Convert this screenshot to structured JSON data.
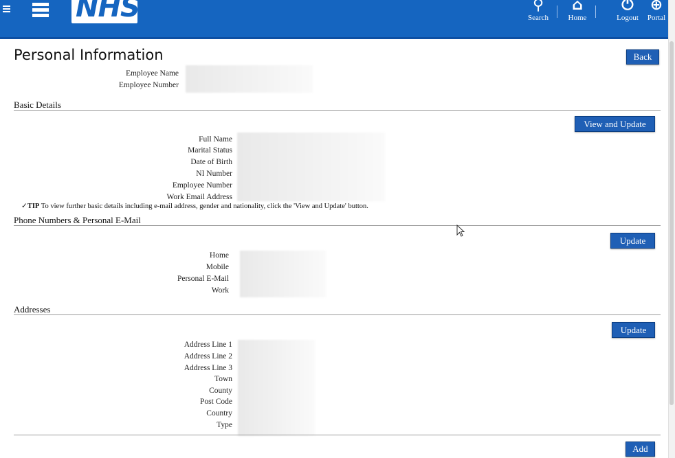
{
  "header": {
    "logo_text": "NHS",
    "nav": [
      {
        "label": "Search",
        "icon": "search-icon",
        "glyph": "⚲"
      },
      {
        "label": "Home",
        "icon": "home-icon",
        "glyph": "⌂"
      },
      {
        "label": "Logout",
        "icon": "power-icon",
        "glyph": "⏻"
      },
      {
        "label": "Portal",
        "icon": "globe-icon",
        "glyph": "⊕"
      }
    ]
  },
  "page": {
    "title": "Personal Information",
    "back_label": "Back",
    "employee_name_label": "Employee Name",
    "employee_number_label": "Employee Number"
  },
  "basic_details": {
    "title": "Basic Details",
    "button_label": "View and Update",
    "fields": [
      "Full Name",
      "Marital Status",
      "Date of Birth",
      "NI Number",
      "Employee Number",
      "Work Email Address"
    ],
    "tip_label": "TIP",
    "tip_text": " To view further basic details including e-mail address, gender and nationality, click the 'View and Update' button."
  },
  "phone": {
    "title": "Phone Numbers & Personal E-Mail",
    "button_label": "Update",
    "fields": [
      "Home",
      "Mobile",
      "Personal E-Mail",
      "Work"
    ]
  },
  "addresses": {
    "title": "Addresses",
    "button_label": "Update",
    "fields": [
      "Address Line 1",
      "Address Line 2",
      "Address Line 3",
      "Town",
      "County",
      "Post Code",
      "Country",
      "Type"
    ],
    "add_label": "Add"
  },
  "colors": {
    "header_blue": "#1565c0",
    "button_blue": "#1f5fb5"
  }
}
